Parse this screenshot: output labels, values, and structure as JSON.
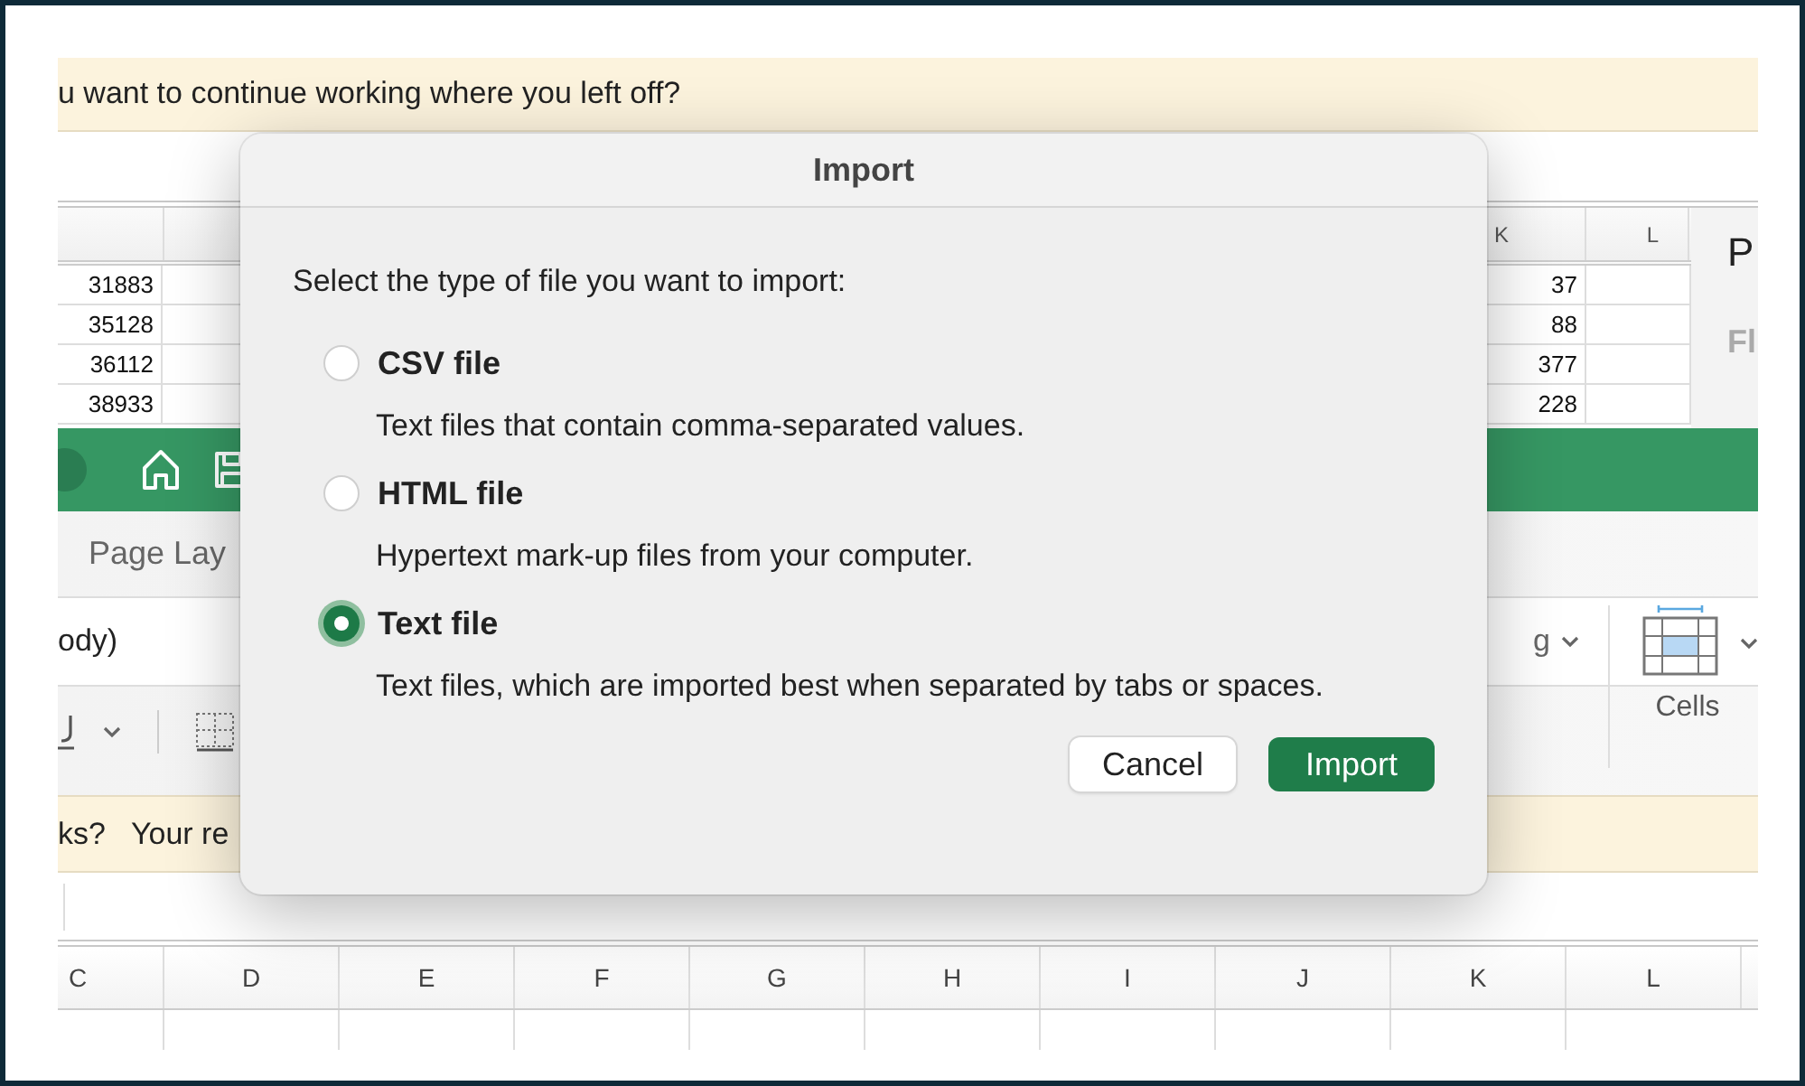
{
  "banner_top": {
    "text": "u want to continue working where you left off?"
  },
  "sheet_top": {
    "left_values": [
      "31883",
      "35128",
      "36112",
      "38933"
    ],
    "columns": [
      "K",
      "L"
    ],
    "k_values": [
      "37",
      "88",
      "377",
      "228"
    ]
  },
  "side_panel": {
    "title": "P",
    "label": "Fl"
  },
  "ribbon": {
    "tab": "Page Lay",
    "font_field": "ody)",
    "partial_label": "g",
    "group_label": "Cells"
  },
  "banner_bottom": {
    "texts": [
      "ks?",
      "Your re"
    ]
  },
  "sheet_bottom": {
    "columns": [
      "C",
      "D",
      "E",
      "F",
      "G",
      "H",
      "I",
      "J",
      "K",
      "L"
    ]
  },
  "dialog": {
    "title": "Import",
    "prompt": "Select the type of file you want to import:",
    "options": [
      {
        "label": "CSV file",
        "description": "Text files that contain comma-separated values.",
        "selected": false
      },
      {
        "label": "HTML file",
        "description": "Hypertext mark-up files from your computer.",
        "selected": false
      },
      {
        "label": "Text file",
        "description": "Text files, which are imported best when separated by tabs or spaces.",
        "selected": true
      }
    ],
    "buttons": [
      {
        "label": "Cancel",
        "kind": "secondary"
      },
      {
        "label": "Import",
        "kind": "primary"
      }
    ]
  }
}
